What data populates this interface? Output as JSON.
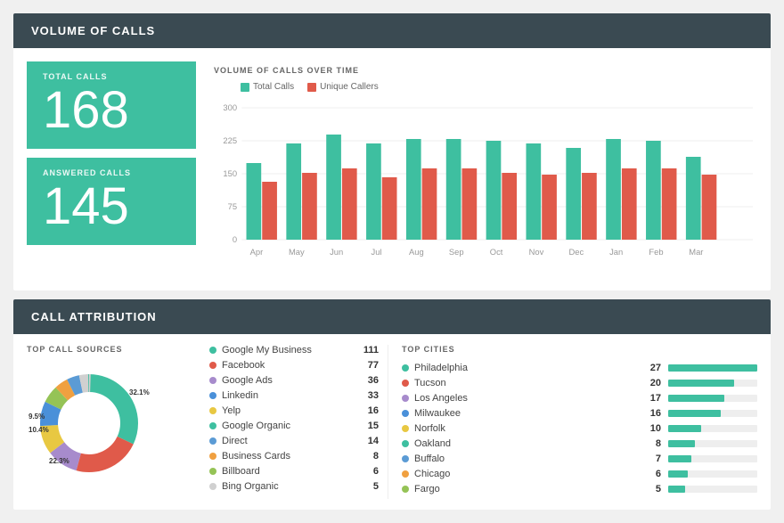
{
  "topSection": {
    "title": "VOLUME OF CALLS",
    "totalCalls": {
      "label": "TOTAL CALLS",
      "value": "168"
    },
    "answeredCalls": {
      "label": "ANSWERED CALLS",
      "value": "145"
    },
    "chart": {
      "title": "VOLUME OF CALLS OVER TIME",
      "legend": {
        "totalCalls": "Total Calls",
        "uniqueCallers": "Unique Callers"
      },
      "yAxisLabels": [
        "300",
        "225",
        "150",
        "75",
        "0"
      ],
      "months": [
        "Apr",
        "May",
        "Jun",
        "Jul",
        "Aug",
        "Sep",
        "Oct",
        "Nov",
        "Dec",
        "Jan",
        "Feb",
        "Mar"
      ],
      "totalCallsData": [
        175,
        220,
        240,
        220,
        230,
        230,
        225,
        220,
        210,
        230,
        225,
        185
      ],
      "uniqueCallersData": [
        130,
        150,
        160,
        140,
        160,
        160,
        150,
        145,
        150,
        160,
        160,
        145
      ]
    }
  },
  "bottomSection": {
    "title": "CALL ATTRIBUTION",
    "topSources": {
      "title": "TOP CALL SOURCES",
      "items": [
        {
          "name": "Google My Business",
          "count": "111",
          "color": "#3ebfa0"
        },
        {
          "name": "Facebook",
          "count": "77",
          "color": "#e05a4a"
        },
        {
          "name": "Google Ads",
          "count": "36",
          "color": "#a78bcc"
        },
        {
          "name": "Linkedin",
          "count": "33",
          "color": "#4a90d9"
        },
        {
          "name": "Yelp",
          "count": "16",
          "color": "#e8c842"
        },
        {
          "name": "Google Organic",
          "count": "15",
          "color": "#3ebfa0"
        },
        {
          "name": "Direct",
          "count": "14",
          "color": "#5b9bd5"
        },
        {
          "name": "Business Cards",
          "count": "8",
          "color": "#f0a040"
        },
        {
          "name": "Billboard",
          "count": "6",
          "color": "#95c356"
        },
        {
          "name": "Bing Organic",
          "count": "5",
          "color": "#d0d0d0"
        }
      ]
    },
    "topCities": {
      "title": "TOP CITIES",
      "maxValue": 27,
      "items": [
        {
          "name": "Philadelphia",
          "count": 27,
          "color": "#3ebfa0"
        },
        {
          "name": "Tucson",
          "count": 20,
          "color": "#e05a4a"
        },
        {
          "name": "Los Angeles",
          "count": 17,
          "color": "#a78bcc"
        },
        {
          "name": "Milwaukee",
          "count": 16,
          "color": "#4a90d9"
        },
        {
          "name": "Norfolk",
          "count": 10,
          "color": "#e8c842"
        },
        {
          "name": "Oakland",
          "count": 8,
          "color": "#3ebfa0"
        },
        {
          "name": "Buffalo",
          "count": 7,
          "color": "#5b9bd5"
        },
        {
          "name": "Chicago",
          "count": 6,
          "color": "#f0a040"
        },
        {
          "name": "Fargo",
          "count": 5,
          "color": "#95c356"
        }
      ]
    },
    "pie": {
      "segments": [
        {
          "color": "#3ebfa0",
          "percent": 32.1,
          "label": "32.1%"
        },
        {
          "color": "#e05a4a",
          "percent": 22.3,
          "label": "22.3%"
        },
        {
          "color": "#a78bcc",
          "percent": 10.4,
          "label": "10.4%"
        },
        {
          "color": "#e8c842",
          "percent": 9.5,
          "label": "9.5%"
        },
        {
          "color": "#4a90d9",
          "percent": 8.2,
          "label": ""
        },
        {
          "color": "#95c356",
          "percent": 5.8,
          "label": ""
        },
        {
          "color": "#f0a040",
          "percent": 4.5,
          "label": ""
        },
        {
          "color": "#5b9bd5",
          "percent": 4.2,
          "label": ""
        },
        {
          "color": "#d0d0d0",
          "percent": 3.0,
          "label": ""
        }
      ]
    }
  }
}
